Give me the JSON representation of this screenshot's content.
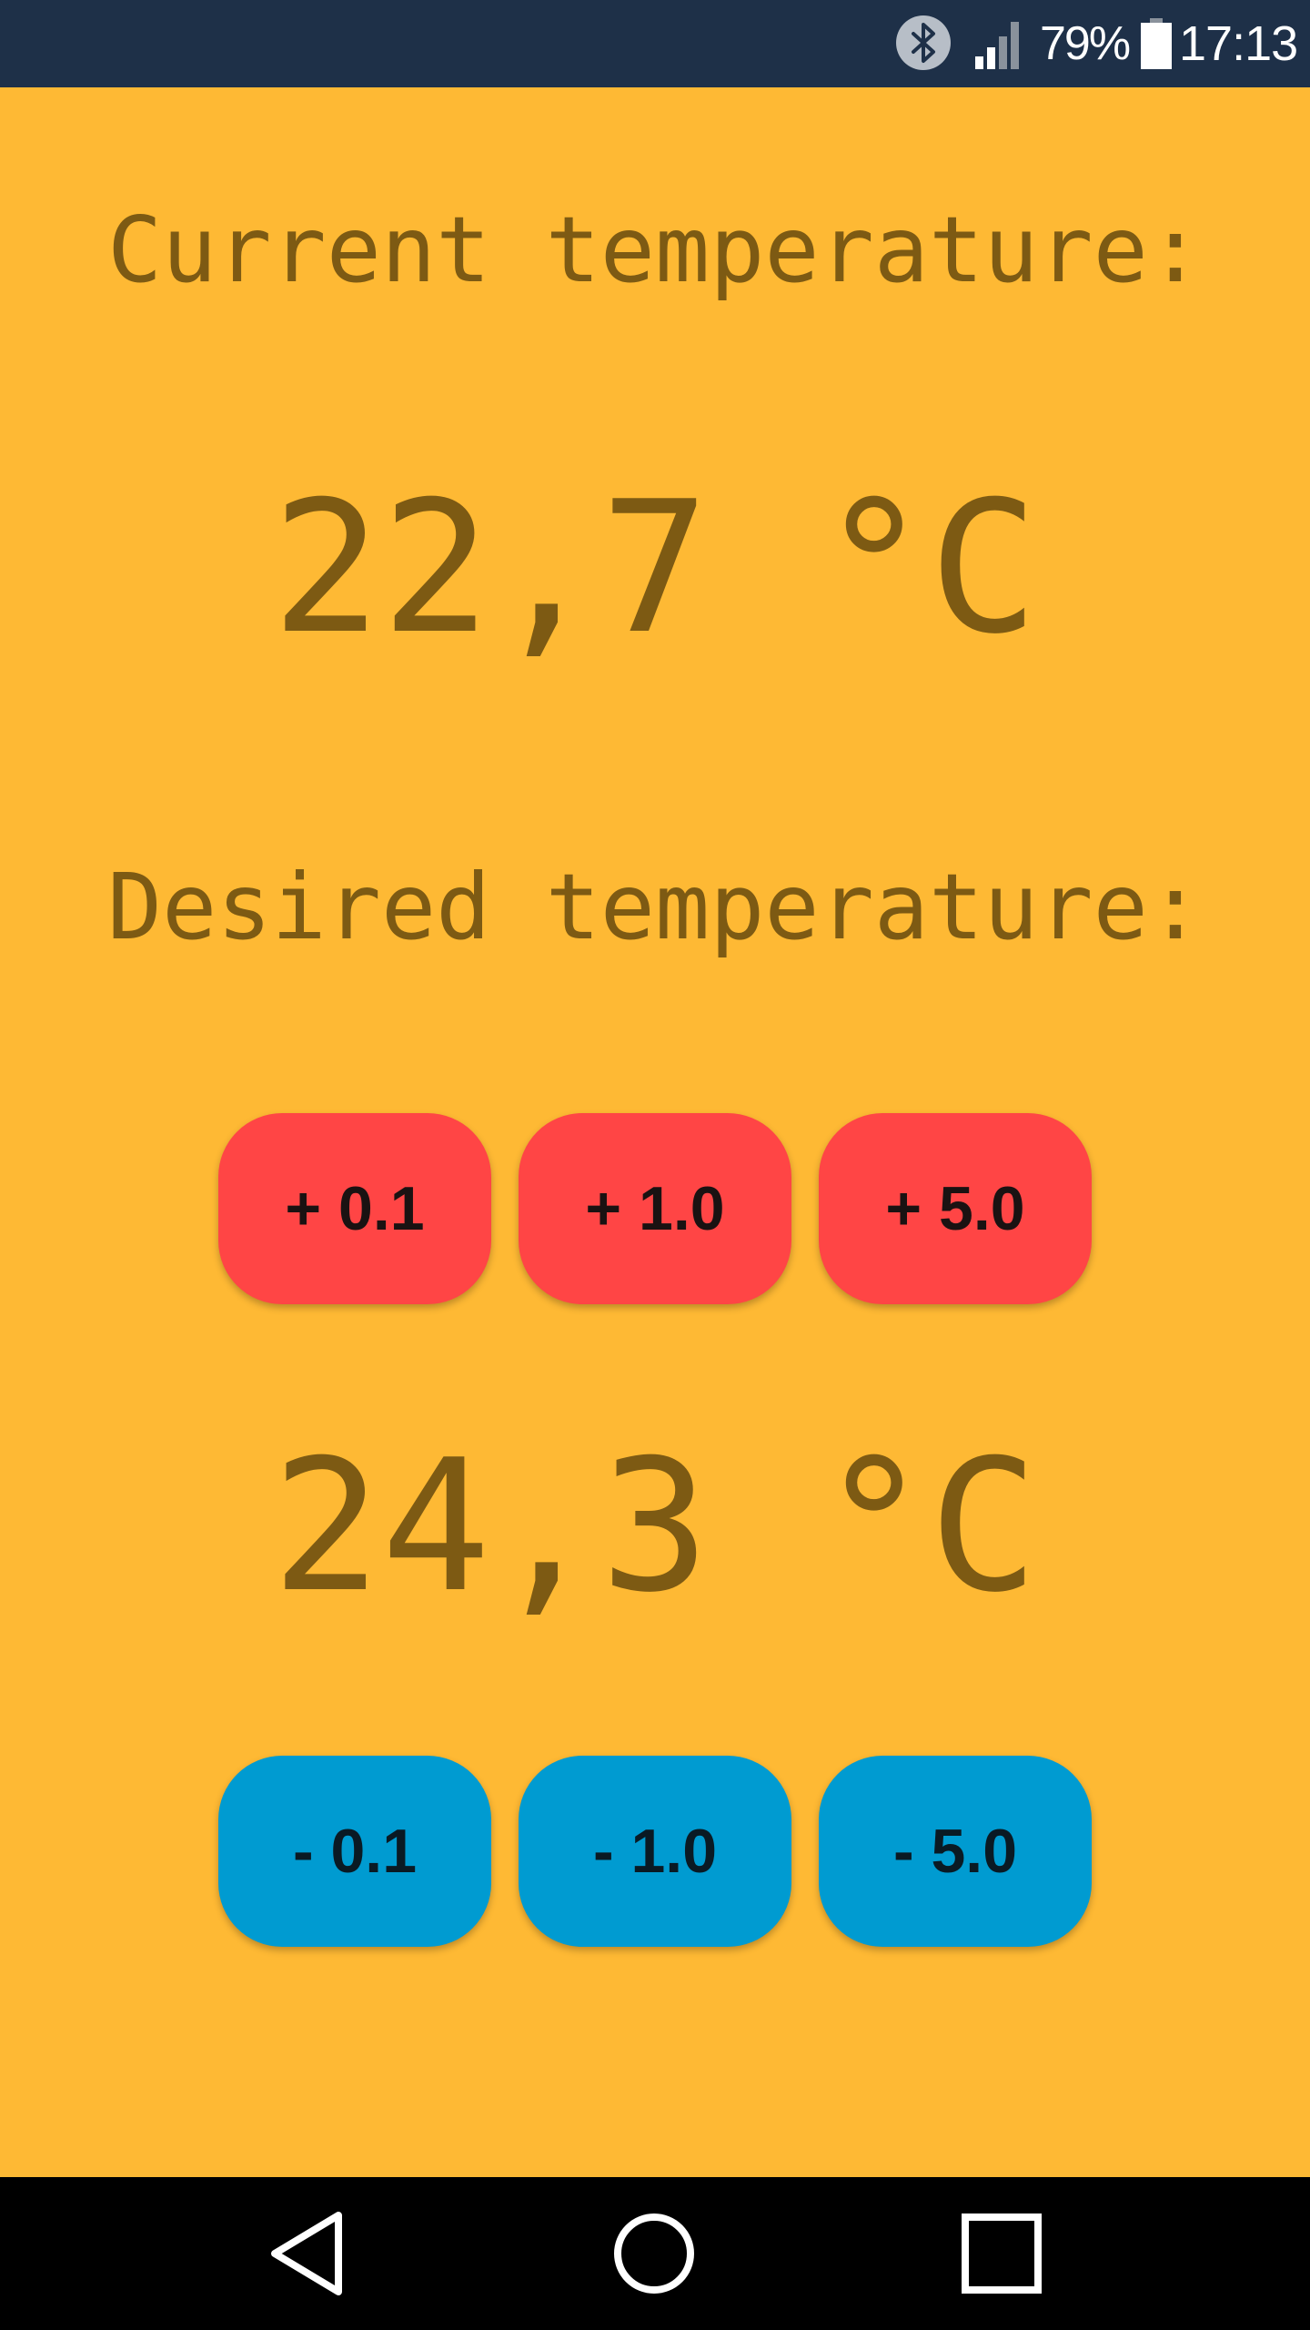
{
  "status_bar": {
    "battery_percent": "79%",
    "time": "17:13",
    "icons": [
      "bluetooth-icon",
      "signal-icon",
      "battery-icon"
    ]
  },
  "current": {
    "label": "Current temperature:",
    "value": "22,7 °C"
  },
  "desired": {
    "label": "Desired temperature:",
    "value": "24,3 °C"
  },
  "increase_buttons": [
    "+ 0.1",
    "+ 1.0",
    "+ 5.0"
  ],
  "decrease_buttons": [
    "- 0.1",
    "- 1.0",
    "- 5.0"
  ],
  "nav_bar": {
    "icons": [
      "back-icon",
      "home-icon",
      "recents-icon"
    ]
  },
  "colors": {
    "background": "#FEB934",
    "text": "#7D5A13",
    "increase": "#FF4545",
    "decrease": "#009BD1",
    "status_bar": "#1E3048",
    "nav_bar": "#000000"
  }
}
